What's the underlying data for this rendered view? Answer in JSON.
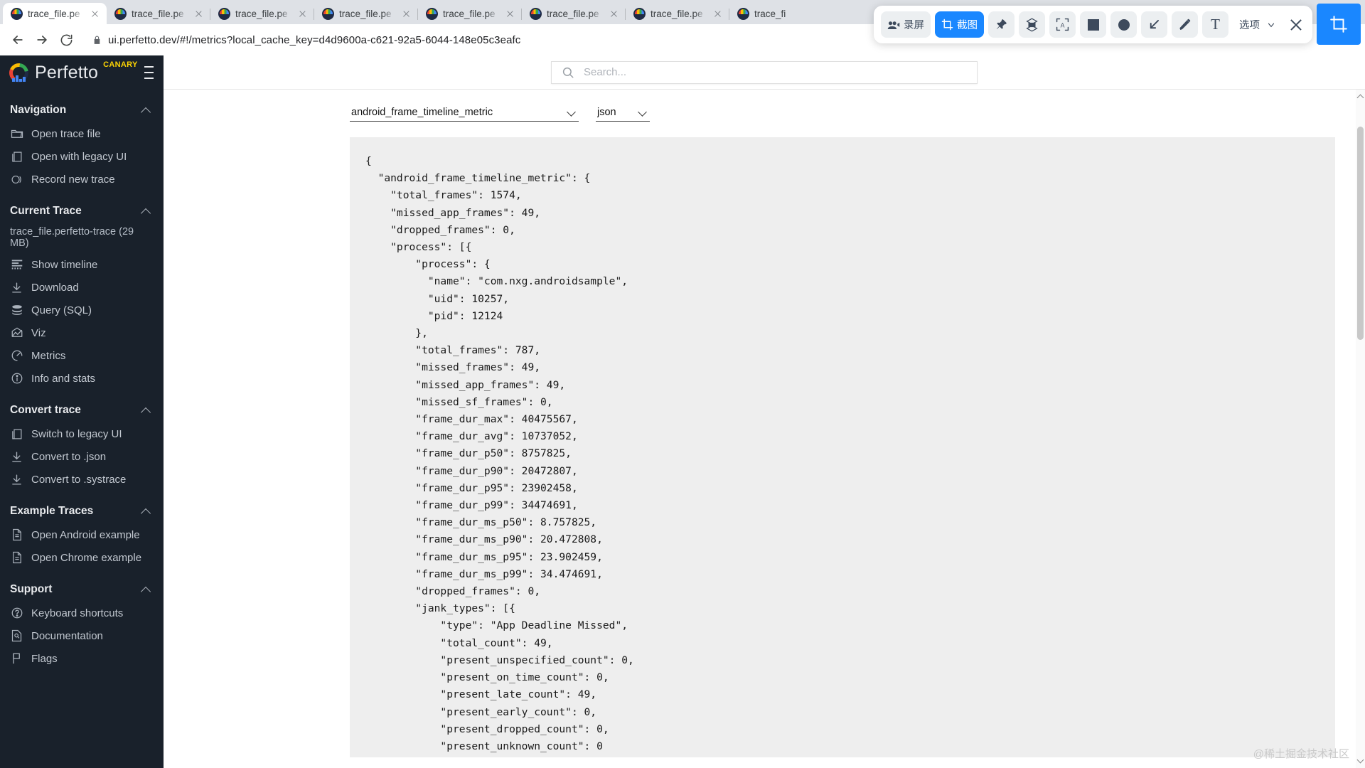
{
  "browser": {
    "tabs": [
      {
        "title": "trace_file.pe",
        "active": true
      },
      {
        "title": "trace_file.pe",
        "active": false
      },
      {
        "title": "trace_file.pe",
        "active": false
      },
      {
        "title": "trace_file.pe",
        "active": false
      },
      {
        "title": "trace_file.pe",
        "active": false
      },
      {
        "title": "trace_file.pe",
        "active": false
      },
      {
        "title": "trace_file.pe",
        "active": false
      },
      {
        "title": "trace_fi",
        "active": false
      }
    ],
    "nav": {
      "back_icon": "back-arrow-icon",
      "forward_icon": "forward-arrow-icon",
      "reload_icon": "reload-icon",
      "lock_icon": "lock-icon"
    },
    "url": "ui.perfetto.dev/#!/metrics?local_cache_key=d4d9600a-c621-92a5-6044-148e05c3eafc"
  },
  "capture_toolbar": {
    "record_label": "录屏",
    "screenshot_label": "截图",
    "options_label": "选项",
    "accent_color": "#1a87ff",
    "icons": [
      "video-camera-icon",
      "crop-icon",
      "pin-icon",
      "cube-icon",
      "ocr-icon",
      "square-icon",
      "circle-icon",
      "arrow-icon",
      "pen-icon",
      "text-icon",
      "chevron-down-icon",
      "close-icon"
    ]
  },
  "sidebar": {
    "brand": "Perfetto",
    "badge": "CANARY",
    "sections": [
      {
        "title": "Navigation",
        "items": [
          {
            "label": "Open trace file",
            "icon": "folder-open-icon"
          },
          {
            "label": "Open with legacy UI",
            "icon": "copy-icon"
          },
          {
            "label": "Record new trace",
            "icon": "record-icon"
          }
        ]
      },
      {
        "title": "Current Trace",
        "file": "trace_file.perfetto-trace (29 MB)",
        "items": [
          {
            "label": "Show timeline",
            "icon": "timeline-icon"
          },
          {
            "label": "Download",
            "icon": "download-icon"
          },
          {
            "label": "Query (SQL)",
            "icon": "database-icon"
          },
          {
            "label": "Viz",
            "icon": "chart-icon"
          },
          {
            "label": "Metrics",
            "icon": "gauge-icon"
          },
          {
            "label": "Info and stats",
            "icon": "info-icon"
          }
        ]
      },
      {
        "title": "Convert trace",
        "items": [
          {
            "label": "Switch to legacy UI",
            "icon": "copy-icon"
          },
          {
            "label": "Convert to .json",
            "icon": "download-icon"
          },
          {
            "label": "Convert to .systrace",
            "icon": "download-icon"
          }
        ]
      },
      {
        "title": "Example Traces",
        "items": [
          {
            "label": "Open Android example",
            "icon": "document-icon"
          },
          {
            "label": "Open Chrome example",
            "icon": "document-icon"
          }
        ]
      },
      {
        "title": "Support",
        "items": [
          {
            "label": "Keyboard shortcuts",
            "icon": "help-circle-icon"
          },
          {
            "label": "Documentation",
            "icon": "book-icon"
          },
          {
            "label": "Flags",
            "icon": "flag-icon"
          }
        ]
      }
    ]
  },
  "topbar": {
    "search_placeholder": "Search..."
  },
  "metrics": {
    "metric_selected": "android_frame_timeline_metric",
    "metric_options": [
      "android_frame_timeline_metric"
    ],
    "format_selected": "json",
    "format_options": [
      "json"
    ],
    "result": "{\n  \"android_frame_timeline_metric\": {\n    \"total_frames\": 1574,\n    \"missed_app_frames\": 49,\n    \"dropped_frames\": 0,\n    \"process\": [{\n        \"process\": {\n          \"name\": \"com.nxg.androidsample\",\n          \"uid\": 10257,\n          \"pid\": 12124\n        },\n        \"total_frames\": 787,\n        \"missed_frames\": 49,\n        \"missed_app_frames\": 49,\n        \"missed_sf_frames\": 0,\n        \"frame_dur_max\": 40475567,\n        \"frame_dur_avg\": 10737052,\n        \"frame_dur_p50\": 8757825,\n        \"frame_dur_p90\": 20472807,\n        \"frame_dur_p95\": 23902458,\n        \"frame_dur_p99\": 34474691,\n        \"frame_dur_ms_p50\": 8.757825,\n        \"frame_dur_ms_p90\": 20.472808,\n        \"frame_dur_ms_p95\": 23.902459,\n        \"frame_dur_ms_p99\": 34.474691,\n        \"dropped_frames\": 0,\n        \"jank_types\": [{\n            \"type\": \"App Deadline Missed\",\n            \"total_count\": 49,\n            \"present_unspecified_count\": 0,\n            \"present_on_time_count\": 0,\n            \"present_late_count\": 49,\n            \"present_early_count\": 0,\n            \"present_dropped_count\": 0,\n            \"present_unknown_count\": 0\n          },"
  },
  "watermark": "@稀土掘金技术社区"
}
